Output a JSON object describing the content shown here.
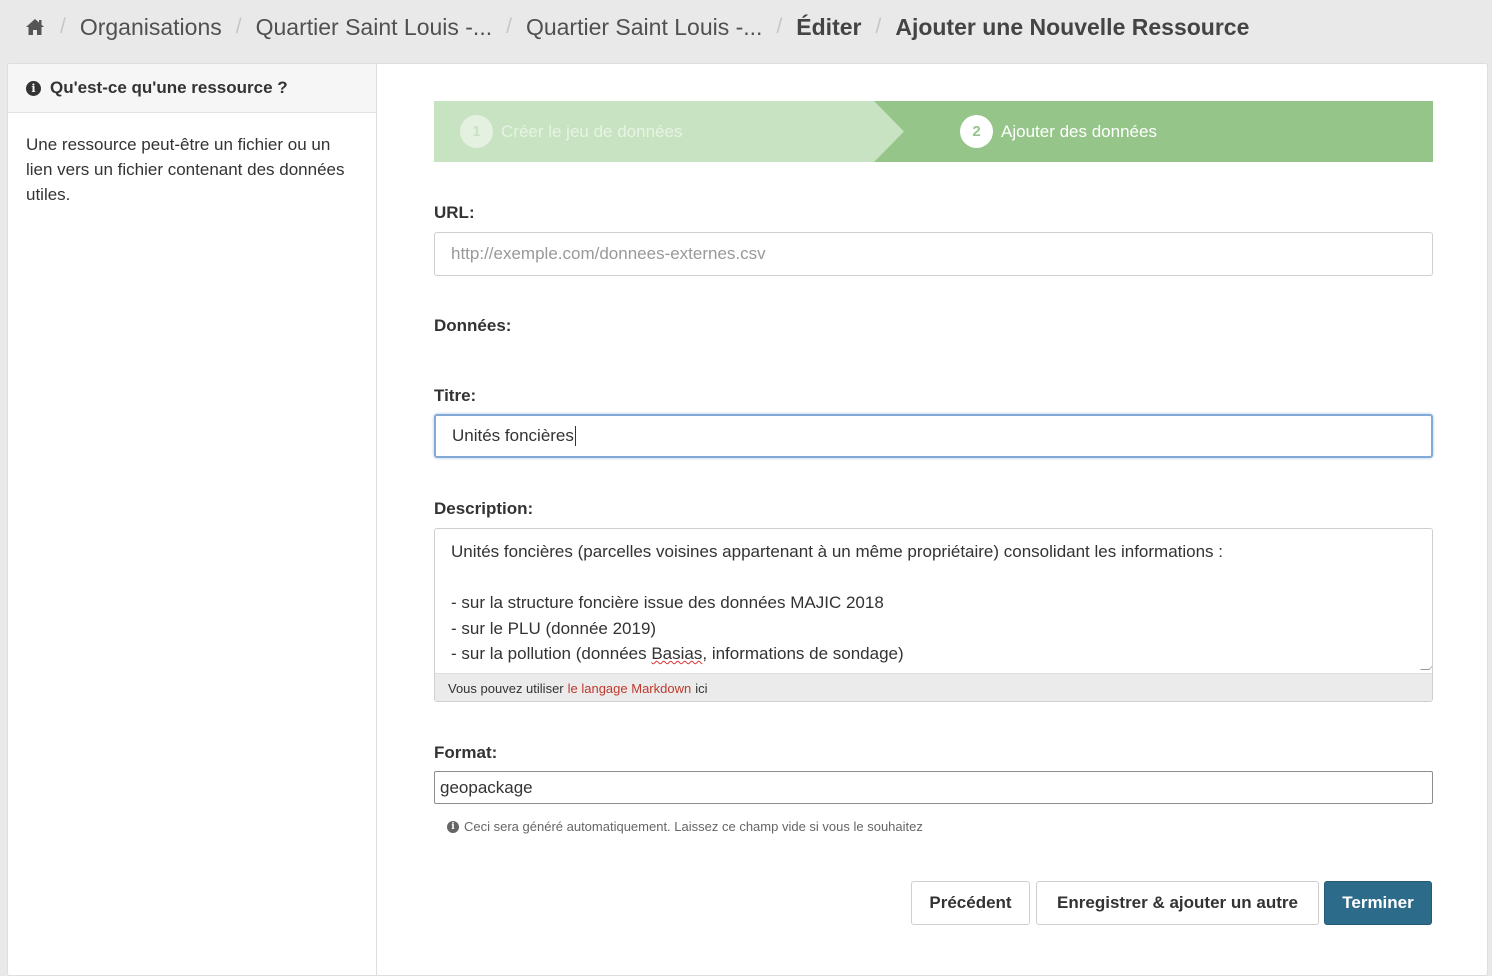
{
  "breadcrumb": {
    "home_icon": "home-icon",
    "items": [
      "Organisations",
      "Quartier Saint Louis -...",
      "Quartier Saint Louis -...",
      "Éditer"
    ],
    "current": "Ajouter une Nouvelle Ressource"
  },
  "sidebar": {
    "heading": "Qu'est-ce qu'une ressource ?",
    "heading_icon": "info-icon",
    "body": "Une ressource peut-être un fichier ou un lien vers un fichier contenant des données utiles."
  },
  "stages": [
    {
      "number": "1",
      "label": "Créer le jeu de données",
      "state": "complete"
    },
    {
      "number": "2",
      "label": "Ajouter des données",
      "state": "active"
    }
  ],
  "form": {
    "url": {
      "label": "URL:",
      "placeholder": "http://exemple.com/donnees-externes.csv",
      "value": ""
    },
    "data_label": "Données:",
    "title": {
      "label": "Titre:",
      "value": "Unités foncières"
    },
    "description": {
      "label": "Description:",
      "lines": [
        "Unités foncières (parcelles voisines appartenant à un même propriétaire) consolidant les informations :",
        "",
        "- sur la structure foncière issue des données MAJIC 2018",
        "- sur le PLU (donnée 2019)"
      ],
      "line5_pre": "- sur la pollution (données ",
      "line5_spell": "Basias",
      "line5_post": ", informations de sondage)",
      "help_pre": "Vous pouvez utiliser",
      "help_link": "le langage Markdown",
      "help_post": "ici"
    },
    "format": {
      "label": "Format:",
      "value": "geopackage",
      "hint": "Ceci sera généré automatiquement. Laissez ce champ vide si vous le souhaitez"
    }
  },
  "buttons": {
    "previous": "Précédent",
    "save_add": "Enregistrer & ajouter un autre",
    "finish": "Terminer"
  },
  "colors": {
    "stage_active": "#95c589",
    "primary_button": "#2d6b8a",
    "link": "#c0392b"
  }
}
